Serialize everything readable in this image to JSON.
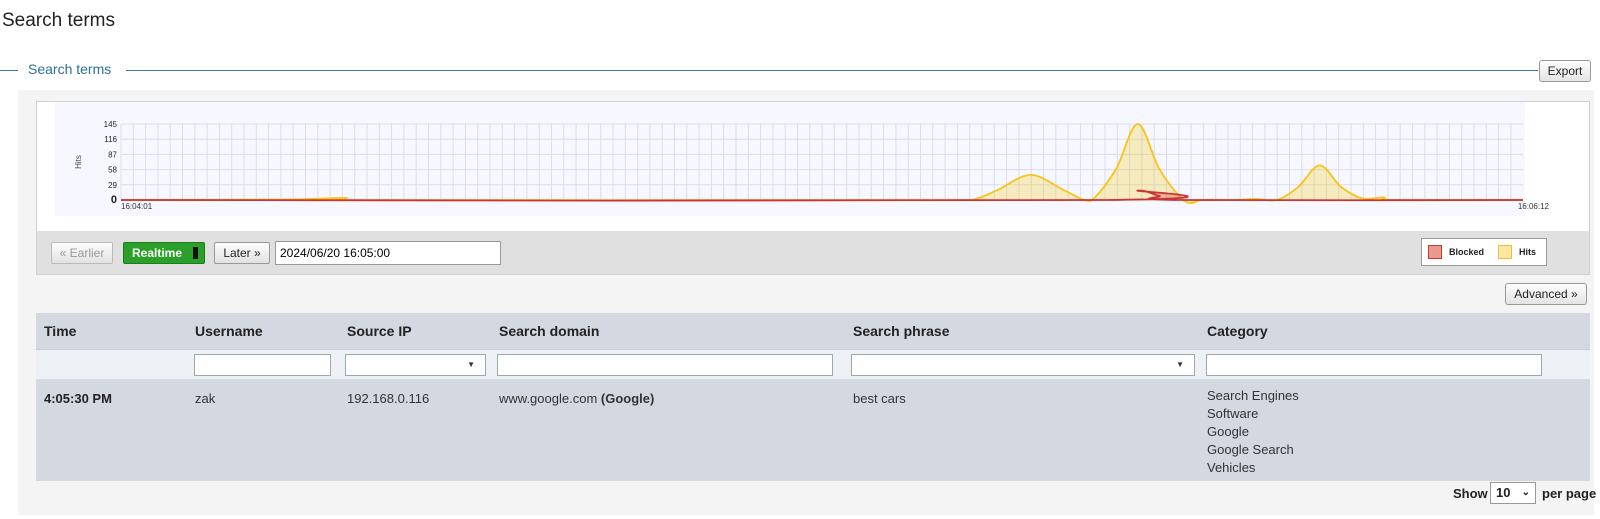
{
  "page": {
    "title": "Search terms"
  },
  "section": {
    "title": "Search terms",
    "export_label": "Export"
  },
  "chart_controls": {
    "earlier_label": "« Earlier",
    "realtime_label": "Realtime",
    "later_label": "Later »",
    "date_value": "2024/06/20 16:05:00",
    "legend": [
      {
        "label": "Blocked",
        "color": "#cc3333"
      },
      {
        "label": "Hits",
        "color": "#f5c518"
      }
    ]
  },
  "advanced_label": "Advanced »",
  "table": {
    "columns": [
      "Time",
      "Username",
      "Source IP",
      "Search domain",
      "Search phrase",
      "Category"
    ],
    "rows": [
      {
        "time": "4:05:30 PM",
        "username": "zak",
        "source_ip": "192.168.0.116",
        "search_domain": "www.google.com",
        "search_domain_name": "(Google)",
        "search_phrase": "best cars",
        "categories": [
          "Search Engines",
          "Software",
          "Google",
          "Google Search",
          "Vehicles"
        ]
      }
    ]
  },
  "pager": {
    "show_label": "Show",
    "page_size": "10",
    "per_page_label": "per page"
  },
  "chart_data": {
    "type": "area",
    "ylabel": "Hits",
    "y_ticks": [
      "0",
      "29",
      "58",
      "87",
      "116",
      "145"
    ],
    "ylim": [
      0,
      145
    ],
    "x_start_label": "16:04:01",
    "x_end_label": "16:06:12",
    "xlim_seconds": [
      0,
      131
    ],
    "grid": true,
    "legend_position": "bottom-right",
    "series": [
      {
        "name": "Hits",
        "color": "#f5c518",
        "points": [
          [
            0,
            0
          ],
          [
            15,
            1
          ],
          [
            21,
            4
          ],
          [
            22,
            0
          ],
          [
            65,
            0
          ],
          [
            78,
            0
          ],
          [
            80,
            3
          ],
          [
            82,
            20
          ],
          [
            85,
            48
          ],
          [
            88,
            20
          ],
          [
            90,
            0
          ],
          [
            91,
            5
          ],
          [
            93,
            60
          ],
          [
            95,
            145
          ],
          [
            97,
            60
          ],
          [
            99,
            5
          ],
          [
            100,
            -6
          ],
          [
            101,
            0
          ],
          [
            104,
            0
          ],
          [
            106,
            2
          ],
          [
            108,
            0
          ],
          [
            110,
            25
          ],
          [
            112,
            66
          ],
          [
            114,
            25
          ],
          [
            116,
            3
          ],
          [
            118,
            5
          ],
          [
            119,
            0
          ],
          [
            131,
            0
          ]
        ]
      },
      {
        "name": "Blocked",
        "color": "#cc3333",
        "points": [
          [
            0,
            0
          ],
          [
            92,
            0
          ],
          [
            95,
            18
          ],
          [
            97,
            8
          ],
          [
            99,
            0
          ],
          [
            131,
            0
          ]
        ]
      }
    ]
  }
}
